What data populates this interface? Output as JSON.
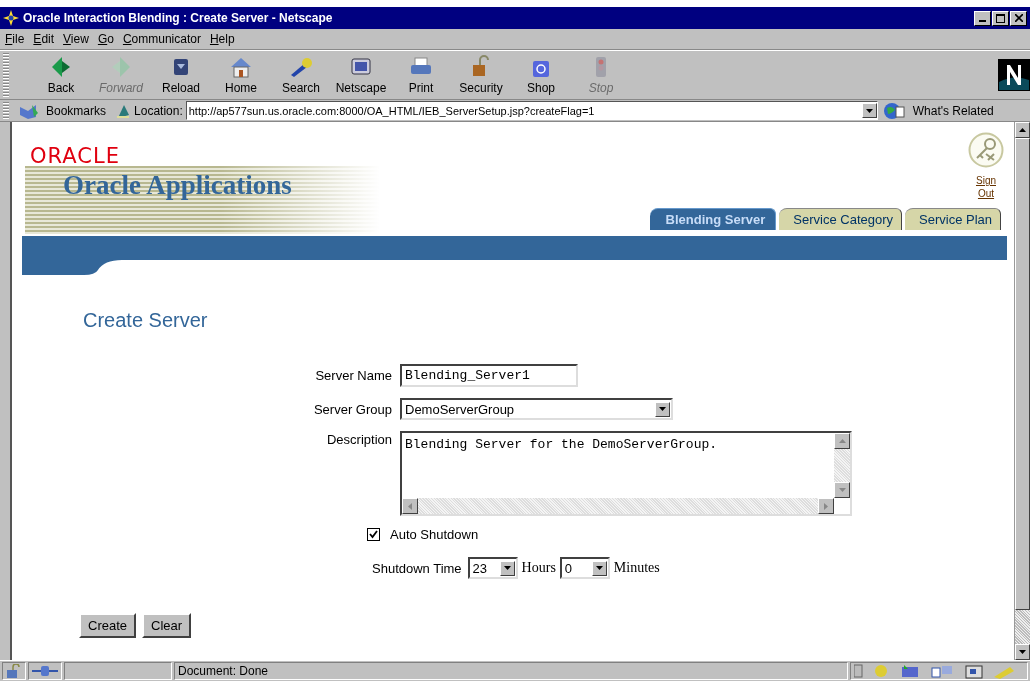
{
  "window": {
    "title": "Oracle Interaction Blending : Create Server - Netscape"
  },
  "menu": [
    "File",
    "Edit",
    "View",
    "Go",
    "Communicator",
    "Help"
  ],
  "toolbar": [
    {
      "kind": "back",
      "label": "Back",
      "disabled": false
    },
    {
      "kind": "forward",
      "label": "Forward",
      "disabled": true
    },
    {
      "kind": "reload",
      "label": "Reload",
      "disabled": false
    },
    {
      "kind": "home",
      "label": "Home",
      "disabled": false
    },
    {
      "kind": "search",
      "label": "Search",
      "disabled": false
    },
    {
      "kind": "netscape",
      "label": "Netscape",
      "disabled": false
    },
    {
      "kind": "print",
      "label": "Print",
      "disabled": false
    },
    {
      "kind": "security",
      "label": "Security",
      "disabled": false
    },
    {
      "kind": "shop",
      "label": "Shop",
      "disabled": false
    },
    {
      "kind": "stop",
      "label": "Stop",
      "disabled": true
    }
  ],
  "location_bar": {
    "bookmarks": "Bookmarks",
    "location_label": "Location:",
    "url": "http://ap577sun.us.oracle.com:8000/OA_HTML/IEB_ServerSetup.jsp?createFlag=1",
    "whats_related": "What's Related"
  },
  "header": {
    "logo": "ORACLE",
    "product": "Oracle Applications",
    "sign_out": "Sign Out"
  },
  "tabs": [
    {
      "label": "Blending Server",
      "selected": true
    },
    {
      "label": "Service Category",
      "selected": false
    },
    {
      "label": "Service Plan",
      "selected": false
    }
  ],
  "form": {
    "title": "Create Server",
    "server_name": {
      "label": "Server Name",
      "value": "Blending_Server1"
    },
    "server_group": {
      "label": "Server Group",
      "value": "DemoServerGroup"
    },
    "description": {
      "label": "Description",
      "value": "Blending Server for the DemoServerGroup."
    },
    "auto_shutdown": {
      "label": "Auto Shutdown",
      "checked": true
    },
    "shutdown_time": {
      "label": "Shutdown Time",
      "hours": "23",
      "hours_label": "Hours",
      "minutes": "0",
      "minutes_label": "Minutes"
    },
    "buttons": [
      "Create",
      "Clear"
    ]
  },
  "status_bar": {
    "text": "Document: Done"
  }
}
